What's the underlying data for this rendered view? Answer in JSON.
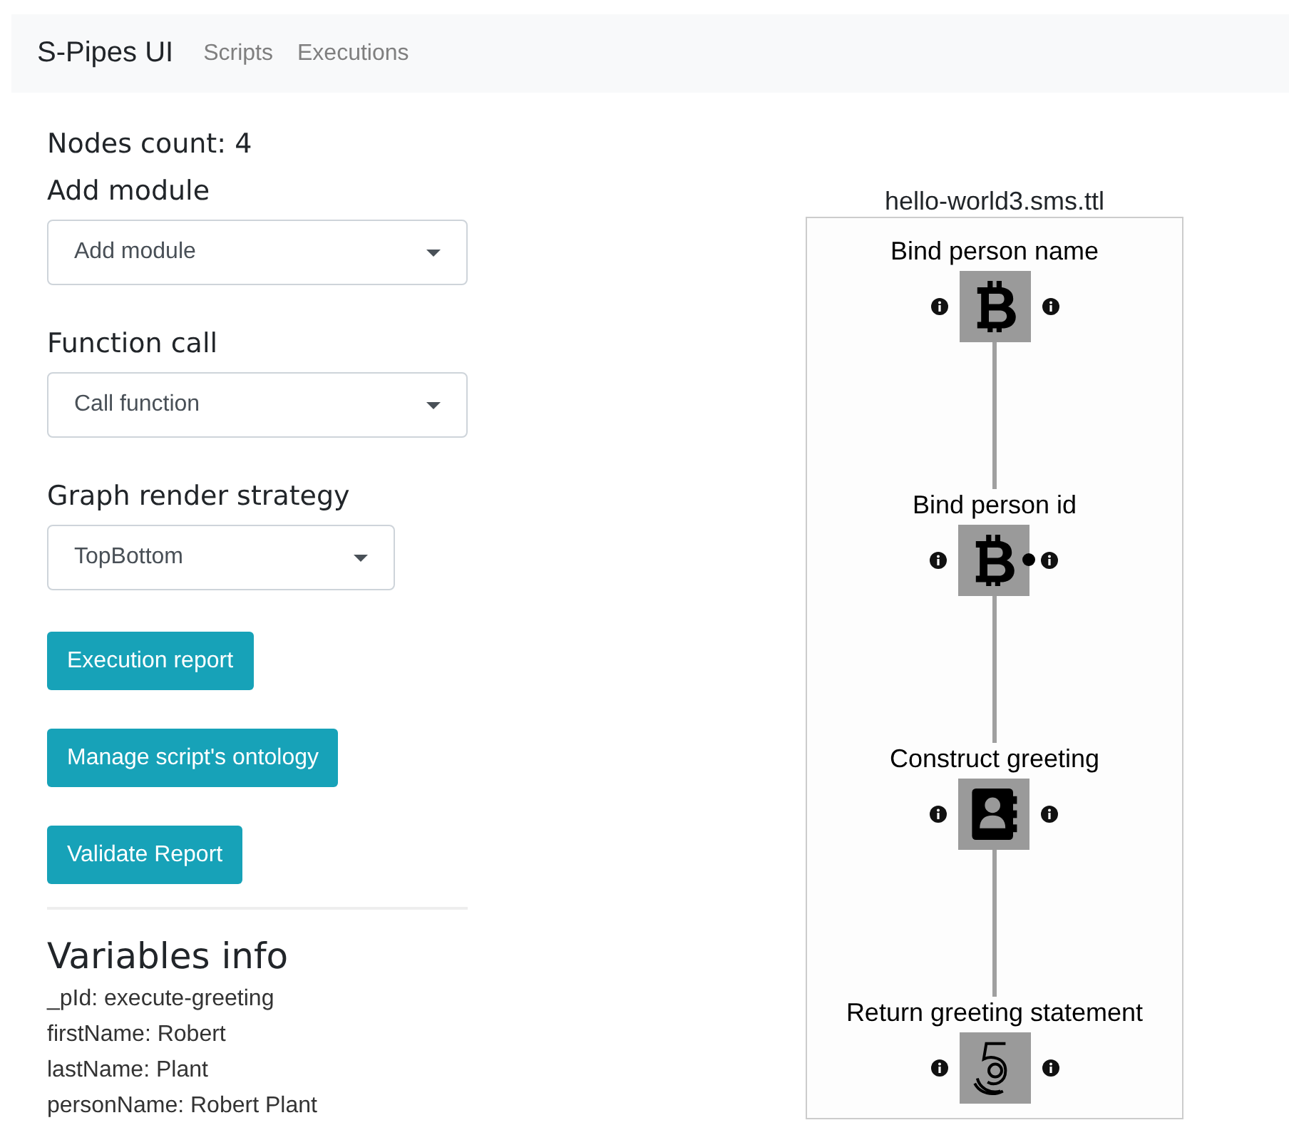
{
  "navbar": {
    "brand": "S-Pipes UI",
    "links": [
      "Scripts",
      "Executions"
    ]
  },
  "nodes_count": "Nodes count: 4",
  "controls": [
    {
      "label": "Add module",
      "value": "Add module"
    },
    {
      "label": "Function call",
      "value": "Call function"
    },
    {
      "label": "Graph render strategy",
      "value": "TopBottom"
    }
  ],
  "buttons": [
    "Execution report",
    "Manage script's ontology",
    "Validate Report"
  ],
  "variables": {
    "title": "Variables info",
    "items": [
      "_pId: execute-greeting",
      "firstName: Robert",
      "lastName: Plant",
      "personName: Robert Plant"
    ]
  },
  "graph": {
    "title": "hello-world3.sms.ttl",
    "nodes": [
      {
        "label": "Bind person name",
        "kind": "bitcoin",
        "dot": false
      },
      {
        "label": "Bind person id",
        "kind": "bitcoin",
        "dot": true
      },
      {
        "label": "Construct greeting",
        "kind": "contact",
        "dot": false
      },
      {
        "label": "Return greeting statement",
        "kind": "spiral",
        "dot": false
      }
    ]
  }
}
